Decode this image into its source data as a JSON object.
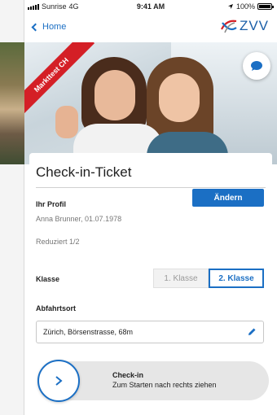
{
  "status_bar": {
    "carrier": "Sunrise",
    "network": "4G",
    "time": "9:41 AM",
    "battery": "100%",
    "battery_level": 1.0
  },
  "nav": {
    "back_label": "Home",
    "logo_text": "ZVV"
  },
  "hero": {
    "banner_text": "Markttest CH",
    "chat_icon": "chat-bubble-icon"
  },
  "ticket": {
    "title": "Check-in-Ticket",
    "profile_label": "Ihr Profil",
    "profile_name": "Anna Brunner, 01.07.1978",
    "discount": "Reduziert 1/2",
    "change_button": "Ändern",
    "class_label": "Klasse",
    "class_options": [
      "1. Klasse",
      "2. Klasse"
    ],
    "class_selected": "2. Klasse",
    "departure_label": "Abfahrtsort",
    "departure_value": "Zürich, Börsenstrasse, 68m",
    "checkin_title": "Check-in",
    "checkin_hint": "Zum Starten nach rechts ziehen"
  },
  "colors": {
    "accent": "#1b6fc4",
    "banner": "#d41f26"
  }
}
